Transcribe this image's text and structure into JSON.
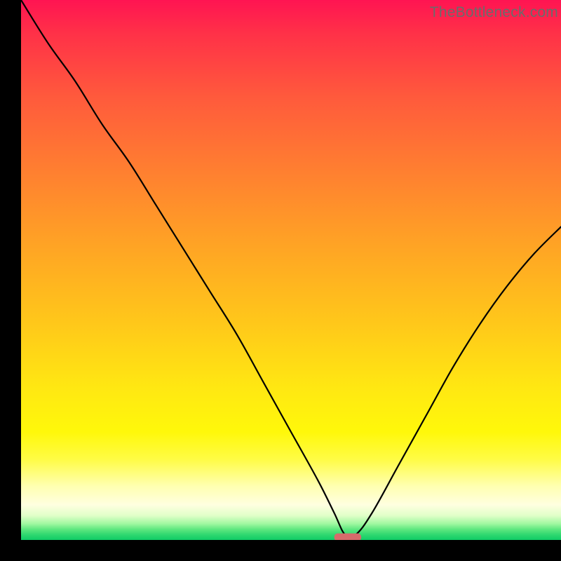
{
  "watermark": "TheBottleneck.com",
  "colors": {
    "background": "#000000",
    "curve": "#000000",
    "marker": "#d76b6b",
    "gradient_top": "#ff1452",
    "gradient_bottom": "#10cc66"
  },
  "chart_data": {
    "type": "line",
    "title": "",
    "xlabel": "",
    "ylabel": "",
    "xlim": [
      0,
      100
    ],
    "ylim": [
      0,
      100
    ],
    "series": [
      {
        "name": "bottleneck-curve",
        "x": [
          0,
          5,
          10,
          15,
          20,
          25,
          30,
          35,
          40,
          45,
          50,
          55,
          58,
          60,
          62,
          65,
          70,
          75,
          80,
          85,
          90,
          95,
          100
        ],
        "y": [
          100,
          92,
          85,
          77,
          70,
          62,
          54,
          46,
          38,
          29,
          20,
          11,
          5,
          1,
          1,
          5,
          14,
          23,
          32,
          40,
          47,
          53,
          58
        ]
      }
    ],
    "marker": {
      "name": "optimal-range",
      "x_start": 58,
      "x_end": 63,
      "y": 0.5
    },
    "annotations": []
  }
}
